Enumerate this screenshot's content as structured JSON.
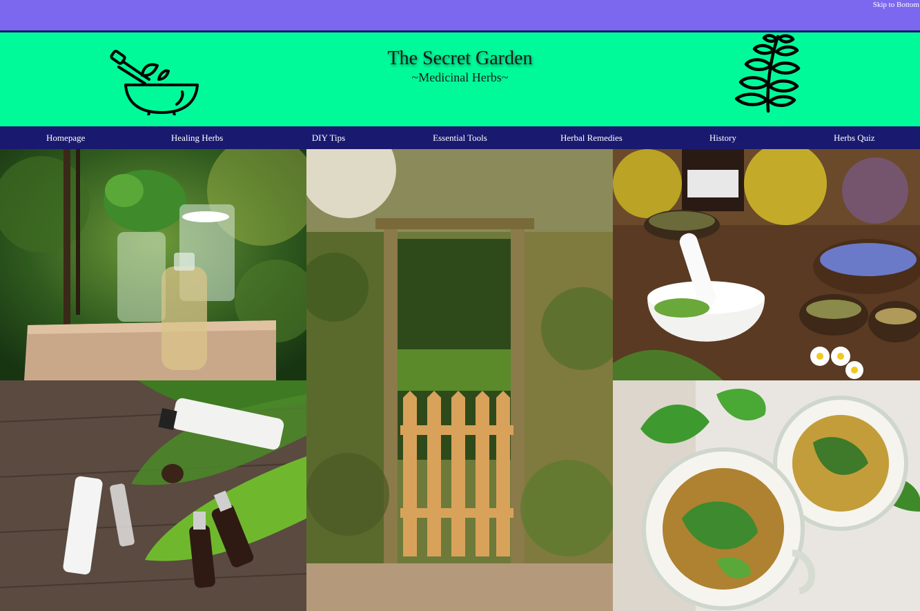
{
  "topbar": {
    "skip_link": "Skip to Bottom",
    "color": "#7b68ee"
  },
  "header": {
    "title": "The Secret Garden",
    "subtitle": "~Medicinal Herbs~",
    "background": "#00fa9a",
    "left_logo": "mortar-pestle-icon",
    "right_logo": "herb-sprig-icon"
  },
  "nav": {
    "background": "#191970",
    "items": [
      {
        "label": "Homepage"
      },
      {
        "label": "Healing Herbs"
      },
      {
        "label": "DIY Tips"
      },
      {
        "label": "Essential Tools"
      },
      {
        "label": "Herbal Remedies"
      },
      {
        "label": "History"
      },
      {
        "label": "Herbs Quiz"
      }
    ]
  },
  "gallery": {
    "images": [
      "herbs-in-glass-vases-photo",
      "garden-gate-photo",
      "mortar-and-herbs-photo",
      "skincare-bottles-photo",
      "herbal-tea-cups-photo"
    ]
  }
}
